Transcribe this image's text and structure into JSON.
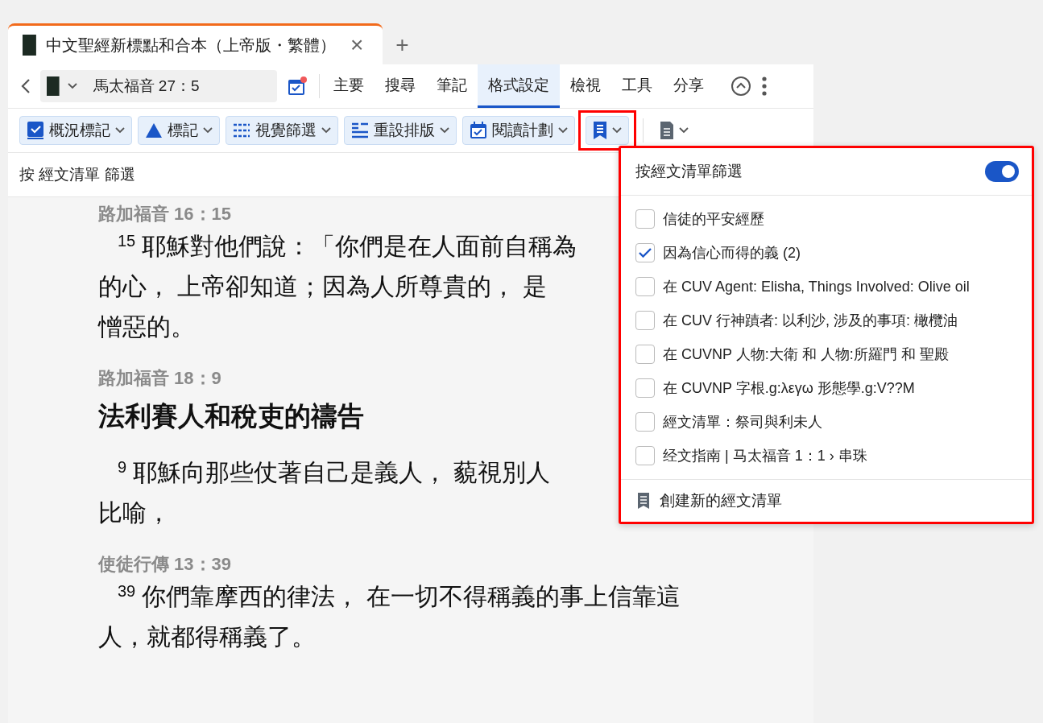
{
  "tab": {
    "title": "中文聖經新標點和合本（上帝版・繁體）",
    "close": "×",
    "add": "+"
  },
  "nav": {
    "reference": "馬太福音 27：5",
    "calendar_alert": true,
    "menu": [
      {
        "label": "主要",
        "selected": false
      },
      {
        "label": "搜尋",
        "selected": false
      },
      {
        "label": "筆記",
        "selected": false
      },
      {
        "label": "格式設定",
        "selected": true
      },
      {
        "label": "檢視",
        "selected": false
      },
      {
        "label": "工具",
        "selected": false
      },
      {
        "label": "分享",
        "selected": false
      }
    ]
  },
  "toolbar": [
    {
      "kind": "summary",
      "label": "概況標記",
      "highlighted": false
    },
    {
      "kind": "triangle",
      "label": "標記",
      "highlighted": false
    },
    {
      "kind": "visual",
      "label": "視覺篩選",
      "highlighted": false
    },
    {
      "kind": "reflow",
      "label": "重設排版",
      "highlighted": false
    },
    {
      "kind": "plan",
      "label": "閱讀計劃",
      "highlighted": false
    },
    {
      "kind": "list",
      "highlighted": true
    },
    {
      "kind": "doc"
    }
  ],
  "filter_bar": {
    "label": "按 經文清單 篩選"
  },
  "passages": [
    {
      "reference": "路加福音 16：15",
      "verse": "15",
      "lines": [
        "耶穌對他們說：「你們是在人面前自稱為",
        "的心， 上帝卻知道；因為人所尊貴的， 是",
        "憎惡的。"
      ]
    },
    {
      "reference": "路加福音 18：9",
      "heading": "法利賽人和稅吏的禱告",
      "verse": "9",
      "lines": [
        "耶穌向那些仗著自己是義人， 藐視別人",
        "比喻，"
      ]
    },
    {
      "reference": "使徒行傳 13：39",
      "verse": "39",
      "lines": [
        "你們靠摩西的律法， 在一切不得稱義的事上信靠這",
        "人，就都得稱義了。"
      ]
    }
  ],
  "dropdown": {
    "title": "按經文清單篩選",
    "on": true,
    "items": [
      {
        "label": "信徒的平安經歷",
        "checked": false
      },
      {
        "label": "因為信心而得的義 (2)",
        "checked": true
      },
      {
        "label": "在 CUV Agent: Elisha, Things Involved: Olive oil",
        "checked": false
      },
      {
        "label": "在 CUV 行神蹟者: 以利沙, 涉及的事項: 橄欖油",
        "checked": false
      },
      {
        "label": "在 CUVNP 人物:大衛 和 人物:所羅門 和 聖殿",
        "checked": false
      },
      {
        "label": "在 CUVNP 字根.g:λεγω 形態學.g:V??M",
        "checked": false
      },
      {
        "label": "經文清單：祭司與利未人",
        "checked": false
      },
      {
        "label": "经文指南 | 马太福音 1：1 › 串珠",
        "checked": false
      }
    ],
    "create": "創建新的經文清單"
  }
}
